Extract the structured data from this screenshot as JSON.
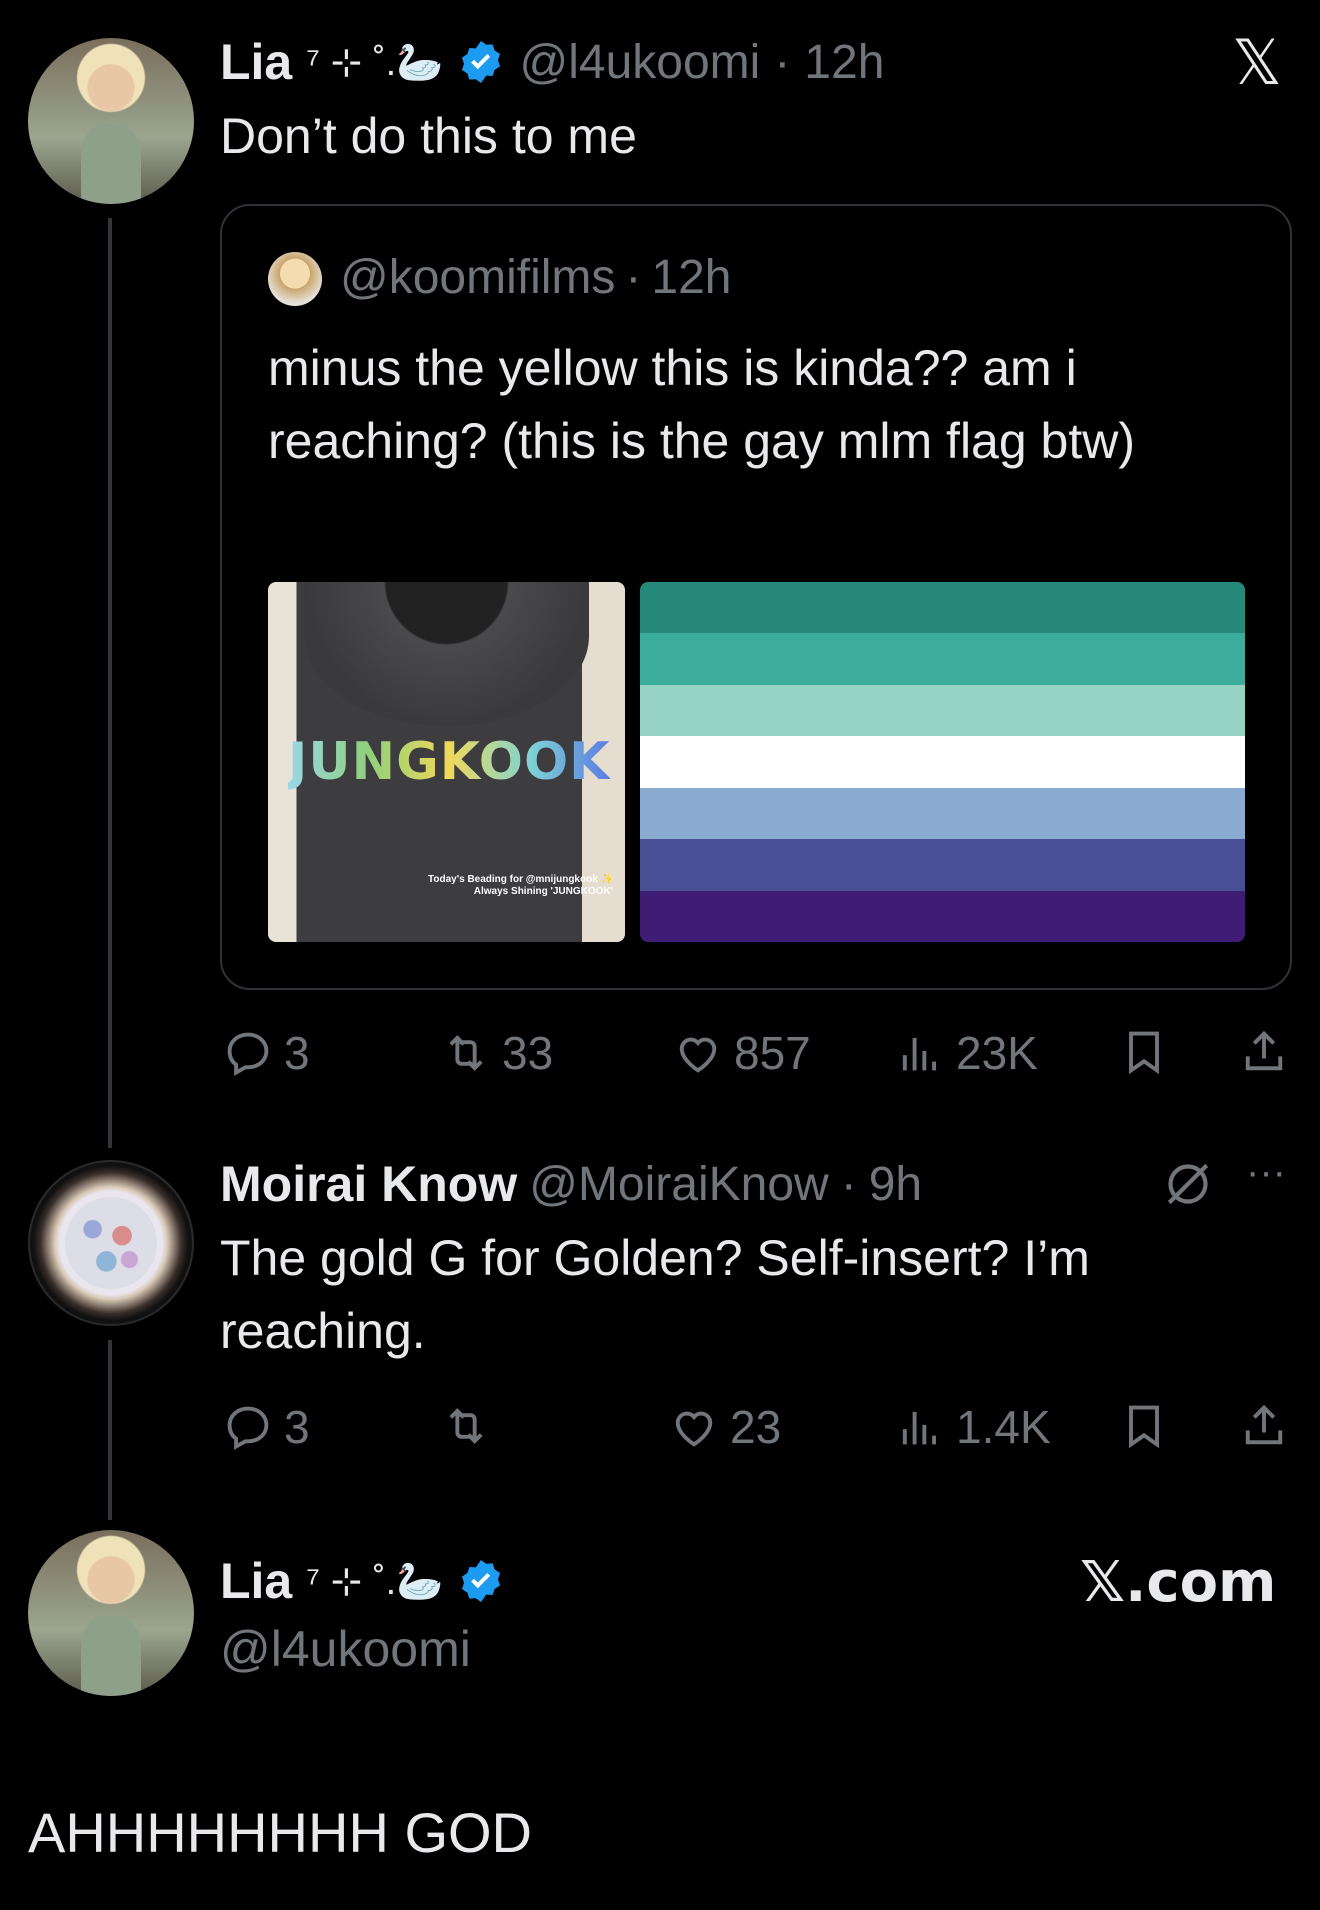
{
  "post1": {
    "author_name": "Lia",
    "author_decor": "⁷ ⊹ ˚.🦢",
    "handle": "@l4ukoomi",
    "time_sep": "·",
    "time": "12h",
    "text": "Don’t do this to me",
    "x_logo": "𝕏",
    "quote": {
      "handle": "@koomifilms",
      "time_sep": "·",
      "time": "12h",
      "text": "minus the yellow this is kinda?? am i reaching? (this is the gay mlm flag btw)",
      "hoodie_word": "JUNGKOOK",
      "hoodie_caption_line1": "Today's Beading for @mnijungkook ✨",
      "hoodie_caption_line2": "Always Shining 'JUNGKOOK'",
      "flag_colors": [
        "#26897a",
        "#3cad9a",
        "#97d3c5",
        "#ffffff",
        "#88abcf",
        "#484f95",
        "#3f1d74"
      ]
    },
    "actions": {
      "replies": "3",
      "reposts": "33",
      "likes": "857",
      "views": "23K"
    }
  },
  "post2": {
    "author_name": "Moirai Know",
    "handle": "@MoiraiKnow",
    "time_sep": "·",
    "time": "9h",
    "text": "The gold G for Golden? Self-insert? I’m reaching.",
    "more_icon": "···",
    "actions": {
      "replies": "3",
      "reposts": "",
      "likes": "23",
      "views": "1.4K"
    }
  },
  "post3": {
    "author_name": "Lia",
    "author_decor": "⁷ ⊹ ˚.🦢",
    "handle": "@l4ukoomi",
    "brand": "𝕏.com",
    "caption": "AHHHHHHHH GOD"
  },
  "colors": {
    "verified": "#1d9bf0",
    "muted": "#71767b",
    "text": "#e7e9ea"
  }
}
